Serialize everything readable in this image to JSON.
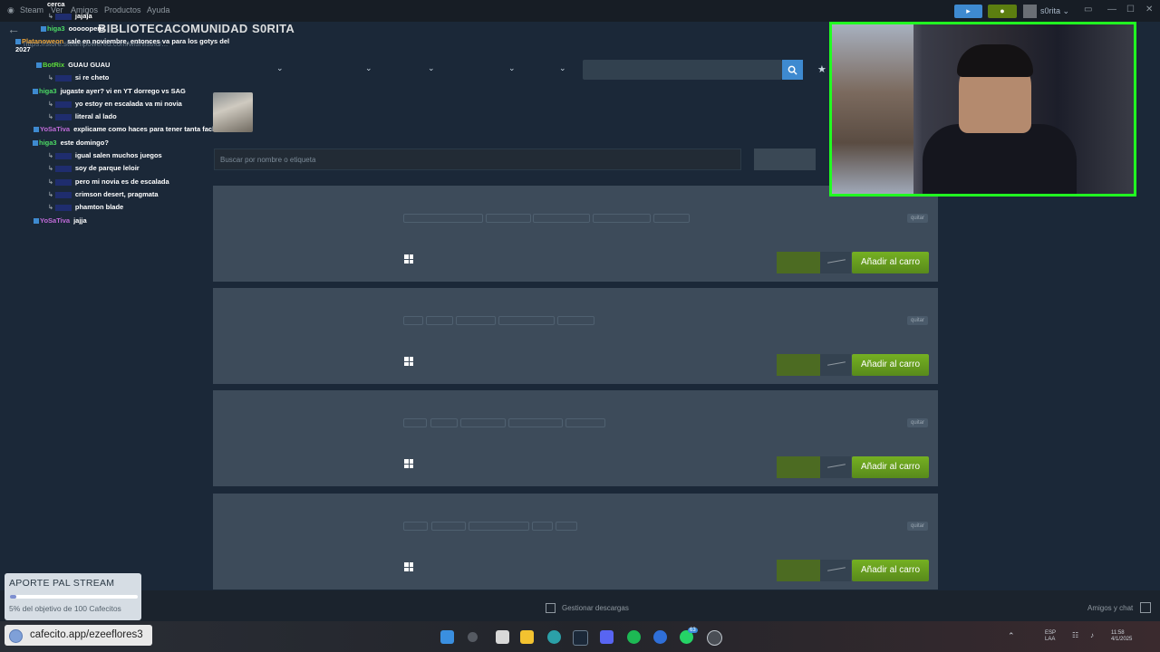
{
  "app": {
    "menu": [
      "Steam",
      "Ver",
      "Amigos",
      "Productos",
      "Ayuda"
    ],
    "nav_tabs": [
      "BIBLIOTECA",
      "COMUNIDAD",
      "S0RITA"
    ],
    "url": "https://store.steampowered.com/wishlist/id/..."
  },
  "header_right": {
    "user_name": "s0rita ⌄"
  },
  "store_search": {
    "placeholder": ""
  },
  "tag_search": {
    "placeholder": "Buscar por nombre o etiqueta"
  },
  "chat": [
    {
      "user": "",
      "message": "cerca",
      "reply": false,
      "user_color": "#ffffff"
    },
    {
      "user": "",
      "message": "jajaja",
      "reply": true,
      "user_color": "#ffffff"
    },
    {
      "user": "higa3",
      "message": "oooooperú",
      "reply": false,
      "user_color": "#4cd964"
    },
    {
      "user": "Platanoweon",
      "message": "sale en noviembre, entonces va para los gotys del 2027",
      "reply": false,
      "user_color": "#e8a23a"
    },
    {
      "user": "BotRix",
      "message": "GUAU GUAU",
      "reply": false,
      "user_color": "#5ddc3a"
    },
    {
      "user": "",
      "message": "si re cheto",
      "reply": true,
      "user_color": "#ffffff"
    },
    {
      "user": "higa3",
      "message": "jugaste ayer? vi en YT dorrego vs SAG",
      "reply": false,
      "user_color": "#4cd964"
    },
    {
      "user": "",
      "message": "yo estoy en escalada va mi novia",
      "reply": true,
      "user_color": "#ffffff"
    },
    {
      "user": "",
      "message": "literal al lado",
      "reply": true,
      "user_color": "#ffffff"
    },
    {
      "user": "YoSaTiva",
      "message": "explicame como haces para tener tanta facha",
      "reply": false,
      "user_color": "#c06bd8"
    },
    {
      "user": "higa3",
      "message": "este domingo?",
      "reply": false,
      "user_color": "#4cd964"
    },
    {
      "user": "",
      "message": "igual salen muchos juegos",
      "reply": true,
      "user_color": "#ffffff"
    },
    {
      "user": "",
      "message": "soy de parque leloir",
      "reply": true,
      "user_color": "#ffffff"
    },
    {
      "user": "",
      "message": "pero mi novia es de escalada",
      "reply": true,
      "user_color": "#ffffff"
    },
    {
      "user": "",
      "message": "crimson desert, pragmata",
      "reply": true,
      "user_color": "#ffffff"
    },
    {
      "user": "",
      "message": "phamton blade",
      "reply": true,
      "user_color": "#ffffff"
    },
    {
      "user": "YoSaTiva",
      "message": "jajja",
      "reply": false,
      "user_color": "#c06bd8"
    }
  ],
  "wishlist": {
    "cards": [
      {
        "remove_label": "quitar",
        "cart_label": "Añadir al carro"
      },
      {
        "remove_label": "quitar",
        "cart_label": "Añadir al carro"
      },
      {
        "remove_label": "quitar",
        "cart_label": "Añadir al carro"
      },
      {
        "remove_label": "quitar",
        "cart_label": "Añadir al carro"
      }
    ]
  },
  "bottom": {
    "downloads_label": "Gestionar descargas",
    "friends_label": "Amigos y chat"
  },
  "overlay": {
    "aporte_title": "APORTE PAL STREAM",
    "aporte_progress": 0.05,
    "aporte_text": "5% del objetivo de 100 Cafecitos",
    "cafecito_url": "cafecito.app/ezeeflores3"
  },
  "taskbar": {
    "whatsapp_badge": "63",
    "tray_lang": "ESP\nLAA",
    "clock": "11:58\n4/1/2025"
  },
  "colors": {
    "accent_blue": "#3e8ad0",
    "cart_green": "#75b022",
    "webcam_border": "#21ff21"
  }
}
